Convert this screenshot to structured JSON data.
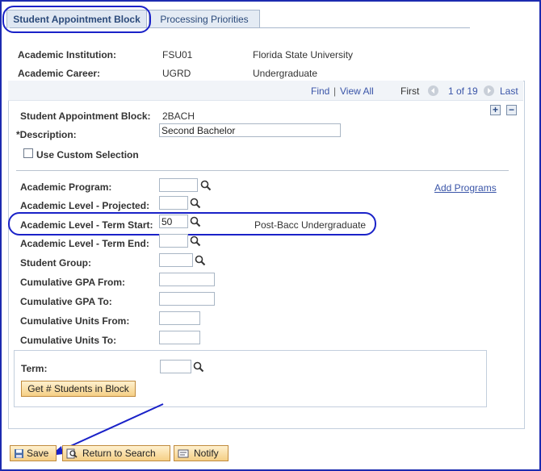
{
  "tabs": [
    {
      "label": "Student Appointment Block",
      "active": true
    },
    {
      "label": "Processing Priorities",
      "active": false
    }
  ],
  "header": {
    "institution_label": "Academic Institution:",
    "institution_code": "FSU01",
    "institution_name": "Florida State University",
    "career_label": "Academic Career:",
    "career_code": "UGRD",
    "career_name": "Undergraduate"
  },
  "nav": {
    "find": "Find",
    "divider": "|",
    "view_all": "View All",
    "first": "First",
    "position": "1 of 19",
    "last": "Last"
  },
  "block": {
    "label": "Student Appointment Block:",
    "value": "2BACH",
    "description_label": "*Description:",
    "description_value": "Second Bachelor",
    "custom_selection_label": "Use Custom Selection"
  },
  "criteria": {
    "program_label": "Academic Program:",
    "level_projected_label": "Academic Level - Projected:",
    "level_term_start_label": "Academic Level - Term Start:",
    "level_term_start_value": "50",
    "level_term_start_desc": "Post-Bacc Undergraduate",
    "level_term_end_label": "Academic Level - Term End:",
    "student_group_label": "Student Group:",
    "gpa_from_label": "Cumulative GPA From:",
    "gpa_to_label": "Cumulative GPA To:",
    "units_from_label": "Cumulative Units From:",
    "units_to_label": "Cumulative Units To:",
    "add_programs": "Add Programs"
  },
  "term": {
    "label": "Term:",
    "button": "Get # Students in Block"
  },
  "toolbar": {
    "save": "Save",
    "return": "Return to Search",
    "notify": "Notify"
  },
  "colors": {
    "annotation": "#1a22c8",
    "link": "#3a55a8",
    "button_border": "#c08a3d"
  }
}
